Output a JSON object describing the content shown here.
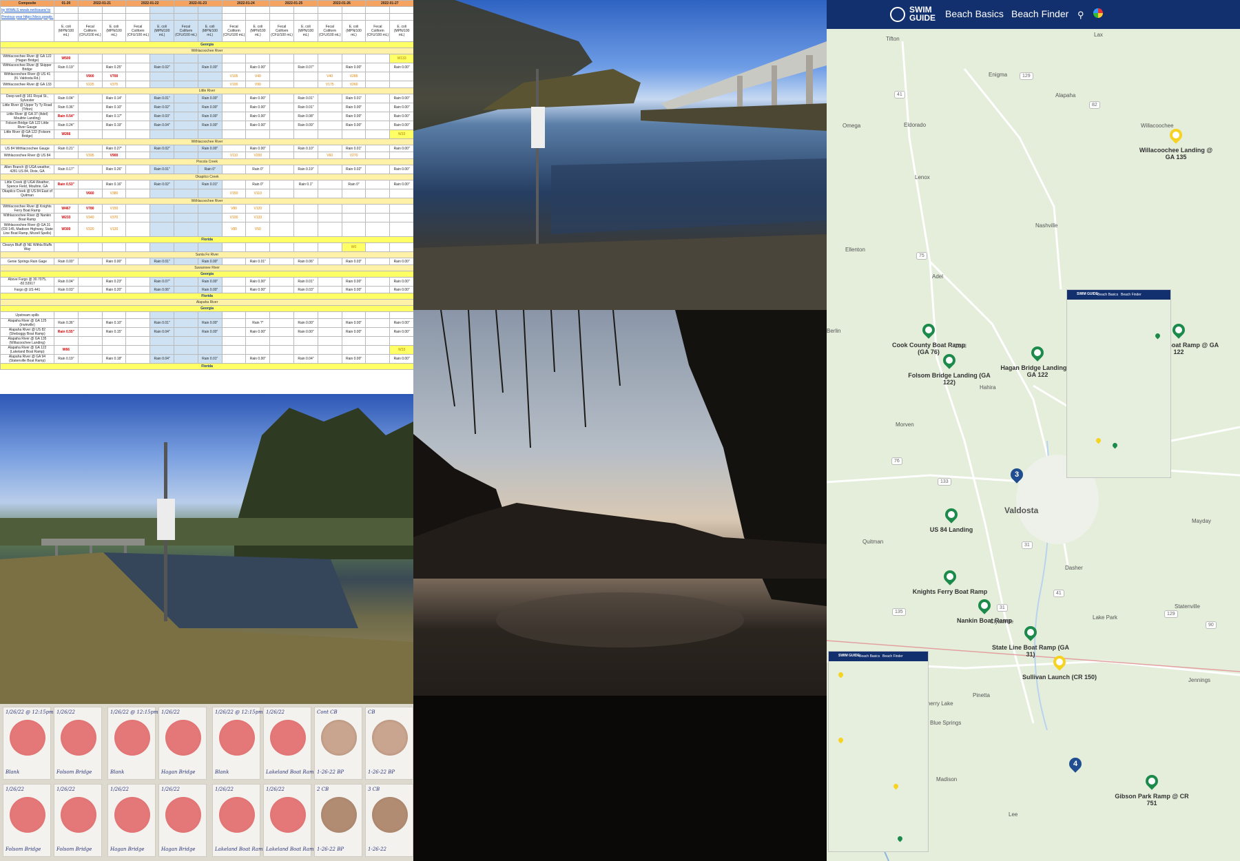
{
  "sheet": {
    "dates": [
      "01-20",
      "2022-01-21",
      "2022-01-22",
      "2022-01-23",
      "2022-01-24",
      "2022-01-25",
      "2022-01-26",
      "2022-01-27"
    ],
    "composite_label": "Composite",
    "link1": "by WWALS wwals.net/issues/ to",
    "link2": "Previous year https://docs.google.",
    "col_headers": [
      "E. coli (MPN/100 mL)",
      "Fecal Coliform (CFU/100 mL)",
      "E. coli (MPN/100 mL)"
    ],
    "rows": [
      {
        "type": "state",
        "site": "Georgia"
      },
      {
        "type": "river",
        "site": "Withlacoochee River"
      },
      {
        "type": "data",
        "site": "Withlacoochee River @ GA 122 (Hagan Bridge)",
        "vals": [
          "W500",
          "",
          "",
          "",
          "",
          "",
          "",
          "",
          "",
          "",
          "",
          "",
          "",
          "",
          "W133"
        ]
      },
      {
        "type": "data",
        "site": "Withlacoochee River @ Skipper Bridge",
        "vals": [
          "Rain 0.19\"",
          "",
          "Rain 0.25\"",
          "",
          "Rain 0.02\"",
          "",
          "Rain 0.00\"",
          "",
          "Rain 0.00\"",
          "",
          "Rain 0.07\"",
          "",
          "Rain 0.00\"",
          "",
          "Rain 0.00\""
        ]
      },
      {
        "type": "data",
        "site": "Withlacoochee River @ US 41 (N. Valdosta Rd.)",
        "vals": [
          "",
          "V900",
          "V700",
          "",
          "",
          "",
          "",
          "V105",
          "V40",
          "",
          "",
          "V40",
          "V285",
          "",
          ""
        ]
      },
      {
        "type": "data",
        "site": "Withlacoochee River @ GA 133",
        "vals": [
          "",
          "V225",
          "V375",
          "",
          "",
          "",
          "",
          "V100",
          "V90",
          "",
          "",
          "V175",
          "V260",
          "",
          ""
        ]
      },
      {
        "type": "river",
        "site": "Little River"
      },
      {
        "type": "data",
        "site": "Deep well @ 161 Royal St., Sylvester",
        "vals": [
          "Rain 0.04\"",
          "",
          "Rain 0.14\"",
          "",
          "Rain 0.01\"",
          "",
          "Rain 0.00\"",
          "",
          "Rain 0.00\"",
          "",
          "Rain 0.01\"",
          "",
          "Rain 0.01\"",
          "",
          "Rain 0.00\""
        ]
      },
      {
        "type": "data",
        "site": "Little River @ Upper Ty Ty Road (Tifton)",
        "vals": [
          "Rain 0.36\"",
          "",
          "Rain 0.10\"",
          "",
          "Rain 0.02\"",
          "",
          "Rain 0.00\"",
          "",
          "Rain 0.00\"",
          "",
          "Rain 0.01\"",
          "",
          "Rain 0.00\"",
          "",
          "Rain 0.00\""
        ]
      },
      {
        "type": "data",
        "site": "Little River @ GA 37 (Adel) Moultrie Landing)",
        "vals": [
          "Rain 0.54\"",
          "",
          "Rain 0.17\"",
          "",
          "Rain 0.03\"",
          "",
          "Rain 0.00\"",
          "",
          "Rain 0.00\"",
          "",
          "Rain 0.08\"",
          "",
          "Rain 0.00\"",
          "",
          "Rain 0.00\""
        ]
      },
      {
        "type": "data",
        "site": "Folsom Bridge GA 122 Little River Gauge",
        "vals": [
          "Rain 0.24\"",
          "",
          "Rain 0.19\"",
          "",
          "Rain 0.04\"",
          "",
          "Rain 0.00\"",
          "",
          "Rain 0.00\"",
          "",
          "Rain 0.09\"",
          "",
          "Rain 0.00\"",
          "",
          "Rain 0.00\""
        ]
      },
      {
        "type": "data",
        "site": "Little River @ GA 122 (Folsom Bridge)",
        "vals": [
          "W266",
          "",
          "",
          "",
          "",
          "",
          "",
          "",
          "",
          "",
          "",
          "",
          "",
          "",
          "W33"
        ]
      },
      {
        "type": "river",
        "site": "Withlacoochee River"
      },
      {
        "type": "data",
        "site": "US 84 Withlacoochee Gauge",
        "vals": [
          "Rain 0.21\"",
          "",
          "Rain 0.27\"",
          "",
          "Rain 0.02\"",
          "",
          "Rain 0.00\"",
          "",
          "Rain 0.00\"",
          "",
          "Rain 0.10\"",
          "",
          "Rain 0.01\"",
          "",
          "Rain 0.00\""
        ]
      },
      {
        "type": "data",
        "site": "Withlacoochee River @ US 84",
        "vals": [
          "",
          "V395",
          "V900",
          "",
          "",
          "",
          "",
          "V110",
          "V200",
          "",
          "",
          "V60",
          "V270",
          "",
          ""
        ]
      },
      {
        "type": "river",
        "site": "Piscola Creek"
      },
      {
        "type": "data",
        "site": "Allen Branch @ UGA weather, 4281 US 84, Dixie, GA",
        "vals": [
          "Rain 0.17\"",
          "",
          "Rain 0.26\"",
          "",
          "Rain 0.01\"",
          "",
          "Rain 0\"",
          "",
          "Rain 0\"",
          "",
          "Rain 0.19\"",
          "",
          "Rain 0.02\"",
          "",
          "Rain 0.00\""
        ]
      },
      {
        "type": "river",
        "site": "Okapilco Creek"
      },
      {
        "type": "data",
        "site": "Little Creek @ UGA Weather, Spence Field, Moultrie, GA",
        "vals": [
          "Rain 0.53\"",
          "",
          "Rain 0.16\"",
          "",
          "Rain 0.02\"",
          "",
          "Rain 0.01\"",
          "",
          "Rain 0\"",
          "",
          "Rain 0.1\"",
          "",
          "Rain 0\"",
          "",
          "Rain 0.00\""
        ]
      },
      {
        "type": "data",
        "site": "Okapilco Creek @ US 84 East of Quitman",
        "vals": [
          "",
          "V660",
          "V380",
          "",
          "",
          "",
          "",
          "V150",
          "V110",
          "",
          "",
          "",
          "",
          "",
          ""
        ]
      },
      {
        "type": "river",
        "site": "Withlacoochee River"
      },
      {
        "type": "data",
        "site": "Withlacoochee River @ Knights Ferry Boat Ramp",
        "vals": [
          "W467",
          "V780",
          "V150",
          "",
          "",
          "",
          "",
          "V80",
          "V120",
          "",
          "",
          "",
          "",
          "",
          ""
        ]
      },
      {
        "type": "data",
        "site": "Withlacoochee River @ Nankin Boat Ramp",
        "vals": [
          "W233",
          "V340",
          "V370",
          "",
          "",
          "",
          "",
          "V100",
          "V133",
          "",
          "",
          "",
          "",
          "",
          ""
        ]
      },
      {
        "type": "data",
        "site": "Withlacoochee River @ GA 31 (CR 145, Madison Highway, State Line Boat Ramp, Mozell Spells)",
        "vals": [
          "W300",
          "V320",
          "V120",
          "",
          "",
          "",
          "",
          "V80",
          "V50",
          "",
          "",
          "",
          "",
          "",
          ""
        ]
      },
      {
        "type": "state",
        "site": "Florida"
      },
      {
        "type": "data",
        "site": "Clearys Bluff @ NE Withla Bluffs Way",
        "vals": [
          "",
          "",
          "",
          "",
          "",
          "",
          "",
          "",
          "",
          "",
          "",
          "",
          "W0",
          "",
          ""
        ]
      },
      {
        "type": "river",
        "site": "Santa Fe River"
      },
      {
        "type": "data",
        "site": "Genie Springs Rain Gage",
        "vals": [
          "Rain 0.00\"",
          "",
          "Rain 0.00\"",
          "",
          "Rain 0.01\"",
          "",
          "Rain 0.00\"",
          "",
          "Rain 0.01\"",
          "",
          "Rain 0.06\"",
          "",
          "Rain 0.03\"",
          "",
          "Rain 0.00\""
        ]
      },
      {
        "type": "river",
        "site": "Suwannee River"
      },
      {
        "type": "state",
        "site": "Georgia"
      },
      {
        "type": "data",
        "site": "Above Fargo @ 30.7075, -82.53917",
        "vals": [
          "Rain 0.04\"",
          "",
          "Rain 0.23\"",
          "",
          "Rain 0.07\"",
          "",
          "Rain 0.00\"",
          "",
          "Rain 0.00\"",
          "",
          "Rain 0.01\"",
          "",
          "Rain 0.00\"",
          "",
          "Rain 0.00\""
        ]
      },
      {
        "type": "data",
        "site": "Fargo @ US 441",
        "vals": [
          "Rain 0.03\"",
          "",
          "Rain 0.20\"",
          "",
          "Rain 0.06\"",
          "",
          "Rain 0.00\"",
          "",
          "Rain 0.00\"",
          "",
          "Rain 0.03\"",
          "",
          "Rain 0.00\"",
          "",
          "Rain 0.00\""
        ]
      },
      {
        "type": "state",
        "site": "Florida"
      },
      {
        "type": "river",
        "site": "Alapaha River"
      },
      {
        "type": "state",
        "site": "Georgia"
      },
      {
        "type": "data",
        "site": "Upstream spills",
        "vals": [
          "",
          "",
          "",
          "",
          "",
          "",
          "",
          "",
          "",
          "",
          "",
          "",
          "",
          "",
          ""
        ]
      },
      {
        "type": "data",
        "site": "Alapaha River @ GA 125 (Irwinville)",
        "vals": [
          "Rain 0.36\"",
          "",
          "Rain 0.10\"",
          "",
          "Rain 0.01\"",
          "",
          "Rain 0.00\"",
          "",
          "Rain ?\"",
          "",
          "Rain 0.00\"",
          "",
          "Rain 0.00\"",
          "",
          "Rain 0.00\""
        ]
      },
      {
        "type": "data",
        "site": "Alapaha River @ US 82 (Sheboggy Boat Ramp)",
        "vals": [
          "Rain 0.55\"",
          "",
          "Rain 0.15\"",
          "",
          "Rain 0.04\"",
          "",
          "Rain 0.00\"",
          "",
          "Rain 0.00\"",
          "",
          "Rain 0.00\"",
          "",
          "Rain 0.00\"",
          "",
          "Rain 0.00\""
        ]
      },
      {
        "type": "data",
        "site": "Alapaha River @ GA 135 (Willacoochee Landing)",
        "vals": [
          "",
          "",
          "",
          "",
          "",
          "",
          "",
          "",
          "",
          "",
          "",
          "",
          "",
          "",
          ""
        ]
      },
      {
        "type": "data",
        "site": "Alapaha River @ GA 122 (Lakeland Boat Ramp)",
        "vals": [
          "W66",
          "",
          "",
          "",
          "",
          "",
          "",
          "",
          "",
          "",
          "",
          "",
          "",
          "",
          "W33"
        ]
      },
      {
        "type": "data",
        "site": "Alapaha River @ GA 94 (Statenville Boat Ramp)",
        "vals": [
          "Rain 0.19\"",
          "",
          "Rain 0.18\"",
          "",
          "Rain 0.04\"",
          "",
          "Rain 0.01\"",
          "",
          "Rain 0.00\"",
          "",
          "Rain 0.04\"",
          "",
          "Rain 0.00\"",
          "",
          "Rain 0.00\""
        ]
      },
      {
        "type": "state",
        "site": "Florida"
      }
    ]
  },
  "plates": [
    {
      "top": "1/26/22 @ 12:15pm",
      "bottom": "Blank"
    },
    {
      "top": "1/26/22",
      "bottom": "Folsom Bridge"
    },
    {
      "top": "1/26/22 @ 12:15pm",
      "bottom": "Blank"
    },
    {
      "top": "1/26/22",
      "bottom": "Hagan Bridge"
    },
    {
      "top": "1/26/22 @ 12:15pm",
      "bottom": "Blank"
    },
    {
      "top": "1/26/22",
      "bottom": "Lakeland Boat Ramp"
    },
    {
      "top": "Cont CB",
      "bottom": "1-26-22 BP"
    },
    {
      "top": "CB",
      "bottom": "1-26-22 BP"
    },
    {
      "top": "1/26/22",
      "bottom": "Folsom Bridge"
    },
    {
      "top": "1/26/22",
      "bottom": "Folsom Bridge"
    },
    {
      "top": "1/26/22",
      "bottom": "Hagan Bridge"
    },
    {
      "top": "1/26/22",
      "bottom": "Hagan Bridge"
    },
    {
      "top": "1/26/22",
      "bottom": "Lakeland Boat Ramp"
    },
    {
      "top": "1/26/22",
      "bottom": "Lakeland Boat Ramp"
    },
    {
      "top": "2 CB",
      "bottom": "1-26-22 BP"
    },
    {
      "top": "3 CB",
      "bottom": "1-26-22"
    }
  ],
  "map": {
    "logo": "SWIM GUIDE",
    "nav": [
      "Beach Basics",
      "Beach Finder"
    ],
    "places": [
      "Tifton",
      "Enigma",
      "Alapaha",
      "Omega",
      "Eldorado",
      "Willacoochee",
      "Lenox",
      "Nashville",
      "Ellenton",
      "Adel",
      "Berlin",
      "Cecil",
      "Hahira",
      "Morven",
      "Valdosta",
      "Quitman",
      "Dasher",
      "Lake Park",
      "Clyattville",
      "Statenville",
      "Mayday",
      "Jennings",
      "Pinetta",
      "Cherry Lake",
      "Blue Springs",
      "Madison",
      "Lee",
      "Lax"
    ],
    "roads": [
      "129",
      "41",
      "82",
      "75",
      "76",
      "133",
      "31",
      "41",
      "31",
      "135",
      "129",
      "90",
      "53"
    ],
    "sites": [
      {
        "name": "Willacoochee Landing @ GA 135",
        "color": "yellow"
      },
      {
        "name": "Cook County Boat Ramp (GA 76)",
        "color": "green"
      },
      {
        "name": "Folsom Bridge Landing (GA 122)",
        "color": "green"
      },
      {
        "name": "Hagan Bridge Landing @ GA 122",
        "color": "green"
      },
      {
        "name": "Lakeland Boat Ramp @ GA 122",
        "color": "green"
      },
      {
        "name": "US 84 Landing",
        "color": "green"
      },
      {
        "name": "Knights Ferry Boat Ramp",
        "color": "green"
      },
      {
        "name": "Nankin Boat Ramp",
        "color": "green"
      },
      {
        "name": "State Line Boat Ramp (GA 31)",
        "color": "green"
      },
      {
        "name": "Sullivan Launch (CR 150)",
        "color": "yellow"
      },
      {
        "name": "Gibson Park Ramp @ CR 751",
        "color": "green"
      }
    ],
    "clusters": [
      "3",
      "4"
    ],
    "colors": {
      "header": "#13306e",
      "green_pin": "#1c8a4a",
      "yellow_pin": "#f5d320",
      "cluster": "#1f4d8f"
    }
  }
}
